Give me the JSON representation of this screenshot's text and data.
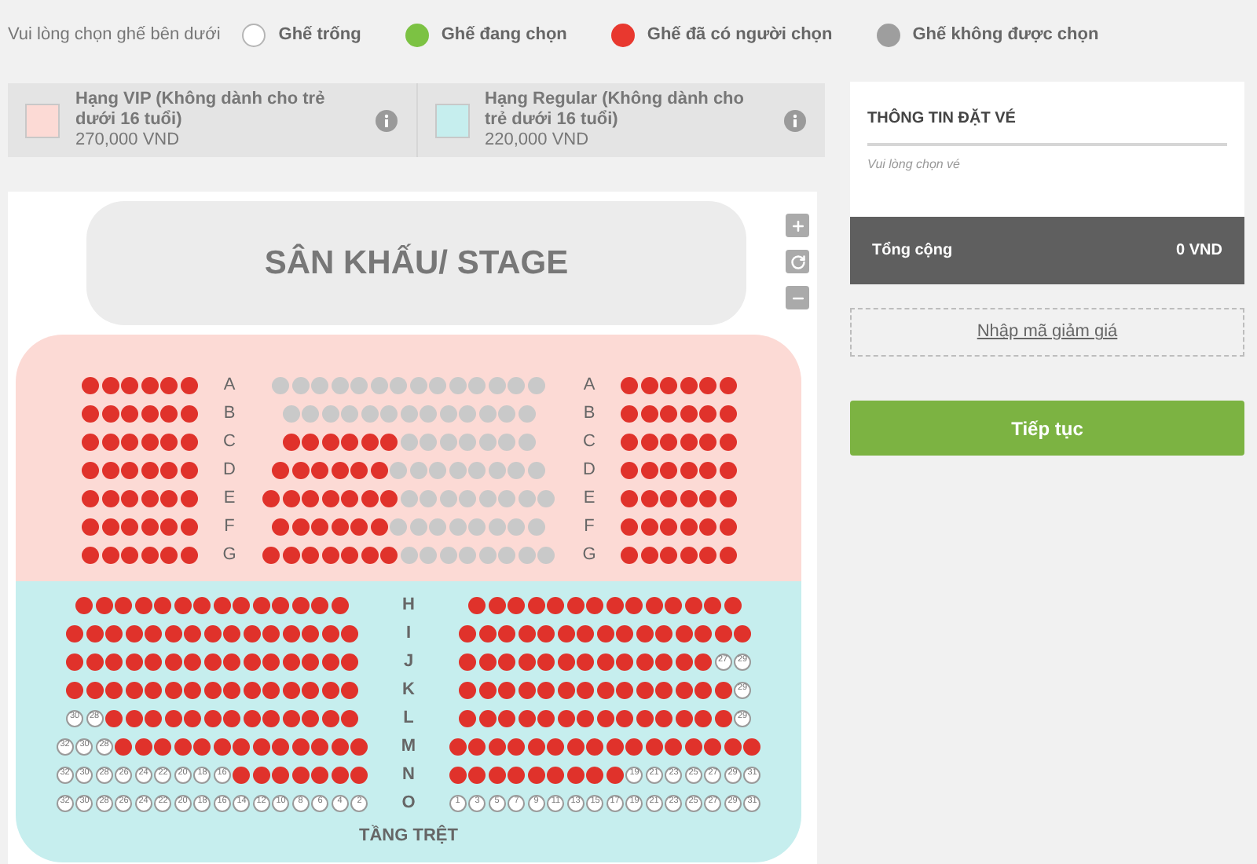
{
  "legend": {
    "prompt": "Vui lòng chọn ghế bên dưới",
    "items": [
      {
        "kind": "free",
        "label": "Ghế trống"
      },
      {
        "kind": "selected",
        "label": "Ghế đang chọn"
      },
      {
        "kind": "taken",
        "label": "Ghế đã có người chọn"
      },
      {
        "kind": "blocked",
        "label": "Ghế không được chọn"
      }
    ]
  },
  "ticket_classes": [
    {
      "name": "Hạng VIP (Không dành cho trẻ dưới 16 tuổi)",
      "price": "270,000 VND",
      "color": "#fcdad5"
    },
    {
      "name": "Hạng Regular (Không dành cho trẻ dưới 16 tuổi)",
      "price": "220,000 VND",
      "color": "#c6eeee"
    }
  ],
  "seat_map": {
    "stage": "SÂN KHẤU/ STAGE",
    "vip_section": {
      "color": "#fcdad5",
      "rows": [
        {
          "label_left": "A",
          "label_right": "A",
          "left": [
            {
              "kind": "taken"
            },
            {
              "kind": "taken"
            },
            {
              "kind": "taken"
            },
            {
              "kind": "taken"
            },
            {
              "kind": "taken"
            },
            {
              "kind": "taken"
            }
          ],
          "center": [
            {
              "kind": "blocked"
            },
            {
              "kind": "blocked"
            },
            {
              "kind": "blocked"
            },
            {
              "kind": "blocked"
            },
            {
              "kind": "blocked"
            },
            {
              "kind": "blocked"
            },
            {
              "kind": "blocked"
            },
            {
              "kind": "blocked"
            },
            {
              "kind": "blocked"
            },
            {
              "kind": "blocked"
            },
            {
              "kind": "blocked"
            },
            {
              "kind": "blocked"
            },
            {
              "kind": "blocked"
            },
            {
              "kind": "blocked"
            }
          ],
          "right": [
            {
              "kind": "taken"
            },
            {
              "kind": "taken"
            },
            {
              "kind": "taken"
            },
            {
              "kind": "taken"
            },
            {
              "kind": "taken"
            },
            {
              "kind": "taken"
            }
          ]
        },
        {
          "label_left": "B",
          "label_right": "B",
          "left": [
            {
              "kind": "taken"
            },
            {
              "kind": "taken"
            },
            {
              "kind": "taken"
            },
            {
              "kind": "taken"
            },
            {
              "kind": "taken"
            },
            {
              "kind": "taken"
            }
          ],
          "center": [
            {
              "kind": "blocked"
            },
            {
              "kind": "blocked"
            },
            {
              "kind": "blocked"
            },
            {
              "kind": "blocked"
            },
            {
              "kind": "blocked"
            },
            {
              "kind": "blocked"
            },
            {
              "kind": "blocked"
            },
            {
              "kind": "blocked"
            },
            {
              "kind": "blocked"
            },
            {
              "kind": "blocked"
            },
            {
              "kind": "blocked"
            },
            {
              "kind": "blocked"
            },
            {
              "kind": "blocked"
            }
          ],
          "right": [
            {
              "kind": "taken"
            },
            {
              "kind": "taken"
            },
            {
              "kind": "taken"
            },
            {
              "kind": "taken"
            },
            {
              "kind": "taken"
            },
            {
              "kind": "taken"
            }
          ]
        },
        {
          "label_left": "C",
          "label_right": "C",
          "left": [
            {
              "kind": "taken"
            },
            {
              "kind": "taken"
            },
            {
              "kind": "taken"
            },
            {
              "kind": "taken"
            },
            {
              "kind": "taken"
            },
            {
              "kind": "taken"
            }
          ],
          "center": [
            {
              "kind": "taken"
            },
            {
              "kind": "taken"
            },
            {
              "kind": "taken"
            },
            {
              "kind": "taken"
            },
            {
              "kind": "taken"
            },
            {
              "kind": "taken"
            },
            {
              "kind": "blocked"
            },
            {
              "kind": "blocked"
            },
            {
              "kind": "blocked"
            },
            {
              "kind": "blocked"
            },
            {
              "kind": "blocked"
            },
            {
              "kind": "blocked"
            },
            {
              "kind": "blocked"
            }
          ],
          "right": [
            {
              "kind": "taken"
            },
            {
              "kind": "taken"
            },
            {
              "kind": "taken"
            },
            {
              "kind": "taken"
            },
            {
              "kind": "taken"
            },
            {
              "kind": "taken"
            }
          ]
        },
        {
          "label_left": "D",
          "label_right": "D",
          "left": [
            {
              "kind": "taken"
            },
            {
              "kind": "taken"
            },
            {
              "kind": "taken"
            },
            {
              "kind": "taken"
            },
            {
              "kind": "taken"
            },
            {
              "kind": "taken"
            }
          ],
          "center": [
            {
              "kind": "taken"
            },
            {
              "kind": "taken"
            },
            {
              "kind": "taken"
            },
            {
              "kind": "taken"
            },
            {
              "kind": "taken"
            },
            {
              "kind": "taken"
            },
            {
              "kind": "blocked"
            },
            {
              "kind": "blocked"
            },
            {
              "kind": "blocked"
            },
            {
              "kind": "blocked"
            },
            {
              "kind": "blocked"
            },
            {
              "kind": "blocked"
            },
            {
              "kind": "blocked"
            },
            {
              "kind": "blocked"
            }
          ],
          "right": [
            {
              "kind": "taken"
            },
            {
              "kind": "taken"
            },
            {
              "kind": "taken"
            },
            {
              "kind": "taken"
            },
            {
              "kind": "taken"
            },
            {
              "kind": "taken"
            }
          ]
        },
        {
          "label_left": "E",
          "label_right": "E",
          "left": [
            {
              "kind": "taken"
            },
            {
              "kind": "taken"
            },
            {
              "kind": "taken"
            },
            {
              "kind": "taken"
            },
            {
              "kind": "taken"
            },
            {
              "kind": "taken"
            }
          ],
          "center": [
            {
              "kind": "taken"
            },
            {
              "kind": "taken"
            },
            {
              "kind": "taken"
            },
            {
              "kind": "taken"
            },
            {
              "kind": "taken"
            },
            {
              "kind": "taken"
            },
            {
              "kind": "taken"
            },
            {
              "kind": "blocked"
            },
            {
              "kind": "blocked"
            },
            {
              "kind": "blocked"
            },
            {
              "kind": "blocked"
            },
            {
              "kind": "blocked"
            },
            {
              "kind": "blocked"
            },
            {
              "kind": "blocked"
            },
            {
              "kind": "blocked"
            }
          ],
          "right": [
            {
              "kind": "taken"
            },
            {
              "kind": "taken"
            },
            {
              "kind": "taken"
            },
            {
              "kind": "taken"
            },
            {
              "kind": "taken"
            },
            {
              "kind": "taken"
            }
          ]
        },
        {
          "label_left": "F",
          "label_right": "F",
          "left": [
            {
              "kind": "taken"
            },
            {
              "kind": "taken"
            },
            {
              "kind": "taken"
            },
            {
              "kind": "taken"
            },
            {
              "kind": "taken"
            },
            {
              "kind": "taken"
            }
          ],
          "center": [
            {
              "kind": "taken"
            },
            {
              "kind": "taken"
            },
            {
              "kind": "taken"
            },
            {
              "kind": "taken"
            },
            {
              "kind": "taken"
            },
            {
              "kind": "taken"
            },
            {
              "kind": "blocked"
            },
            {
              "kind": "blocked"
            },
            {
              "kind": "blocked"
            },
            {
              "kind": "blocked"
            },
            {
              "kind": "blocked"
            },
            {
              "kind": "blocked"
            },
            {
              "kind": "blocked"
            },
            {
              "kind": "blocked"
            }
          ],
          "right": [
            {
              "kind": "taken"
            },
            {
              "kind": "taken"
            },
            {
              "kind": "taken"
            },
            {
              "kind": "taken"
            },
            {
              "kind": "taken"
            },
            {
              "kind": "taken"
            }
          ]
        },
        {
          "label_left": "G",
          "label_right": "G",
          "left": [
            {
              "kind": "taken"
            },
            {
              "kind": "taken"
            },
            {
              "kind": "taken"
            },
            {
              "kind": "taken"
            },
            {
              "kind": "taken"
            },
            {
              "kind": "taken"
            }
          ],
          "center": [
            {
              "kind": "taken"
            },
            {
              "kind": "taken"
            },
            {
              "kind": "taken"
            },
            {
              "kind": "taken"
            },
            {
              "kind": "taken"
            },
            {
              "kind": "taken"
            },
            {
              "kind": "taken"
            },
            {
              "kind": "blocked"
            },
            {
              "kind": "blocked"
            },
            {
              "kind": "blocked"
            },
            {
              "kind": "blocked"
            },
            {
              "kind": "blocked"
            },
            {
              "kind": "blocked"
            },
            {
              "kind": "blocked"
            },
            {
              "kind": "blocked"
            }
          ],
          "right": [
            {
              "kind": "taken"
            },
            {
              "kind": "taken"
            },
            {
              "kind": "taken"
            },
            {
              "kind": "taken"
            },
            {
              "kind": "taken"
            },
            {
              "kind": "taken"
            }
          ]
        }
      ]
    },
    "regular_section": {
      "color": "#c6eeee",
      "title": "TẦNG TRỆT",
      "rows": [
        {
          "label": "H",
          "left": [
            {
              "kind": "taken"
            },
            {
              "kind": "taken"
            },
            {
              "kind": "taken"
            },
            {
              "kind": "taken"
            },
            {
              "kind": "taken"
            },
            {
              "kind": "taken"
            },
            {
              "kind": "taken"
            },
            {
              "kind": "taken"
            },
            {
              "kind": "taken"
            },
            {
              "kind": "taken"
            },
            {
              "kind": "taken"
            },
            {
              "kind": "taken"
            },
            {
              "kind": "taken"
            },
            {
              "kind": "taken"
            }
          ],
          "right": [
            {
              "kind": "taken"
            },
            {
              "kind": "taken"
            },
            {
              "kind": "taken"
            },
            {
              "kind": "taken"
            },
            {
              "kind": "taken"
            },
            {
              "kind": "taken"
            },
            {
              "kind": "taken"
            },
            {
              "kind": "taken"
            },
            {
              "kind": "taken"
            },
            {
              "kind": "taken"
            },
            {
              "kind": "taken"
            },
            {
              "kind": "taken"
            },
            {
              "kind": "taken"
            },
            {
              "kind": "taken"
            }
          ]
        },
        {
          "label": "I",
          "left": [
            {
              "kind": "taken"
            },
            {
              "kind": "taken"
            },
            {
              "kind": "taken"
            },
            {
              "kind": "taken"
            },
            {
              "kind": "taken"
            },
            {
              "kind": "taken"
            },
            {
              "kind": "taken"
            },
            {
              "kind": "taken"
            },
            {
              "kind": "taken"
            },
            {
              "kind": "taken"
            },
            {
              "kind": "taken"
            },
            {
              "kind": "taken"
            },
            {
              "kind": "taken"
            },
            {
              "kind": "taken"
            },
            {
              "kind": "taken"
            }
          ],
          "right": [
            {
              "kind": "taken"
            },
            {
              "kind": "taken"
            },
            {
              "kind": "taken"
            },
            {
              "kind": "taken"
            },
            {
              "kind": "taken"
            },
            {
              "kind": "taken"
            },
            {
              "kind": "taken"
            },
            {
              "kind": "taken"
            },
            {
              "kind": "taken"
            },
            {
              "kind": "taken"
            },
            {
              "kind": "taken"
            },
            {
              "kind": "taken"
            },
            {
              "kind": "taken"
            },
            {
              "kind": "taken"
            },
            {
              "kind": "taken"
            }
          ]
        },
        {
          "label": "J",
          "left": [
            {
              "kind": "taken"
            },
            {
              "kind": "taken"
            },
            {
              "kind": "taken"
            },
            {
              "kind": "taken"
            },
            {
              "kind": "taken"
            },
            {
              "kind": "taken"
            },
            {
              "kind": "taken"
            },
            {
              "kind": "taken"
            },
            {
              "kind": "taken"
            },
            {
              "kind": "taken"
            },
            {
              "kind": "taken"
            },
            {
              "kind": "taken"
            },
            {
              "kind": "taken"
            },
            {
              "kind": "taken"
            },
            {
              "kind": "taken"
            }
          ],
          "right": [
            {
              "kind": "taken"
            },
            {
              "kind": "taken"
            },
            {
              "kind": "taken"
            },
            {
              "kind": "taken"
            },
            {
              "kind": "taken"
            },
            {
              "kind": "taken"
            },
            {
              "kind": "taken"
            },
            {
              "kind": "taken"
            },
            {
              "kind": "taken"
            },
            {
              "kind": "taken"
            },
            {
              "kind": "taken"
            },
            {
              "kind": "taken"
            },
            {
              "kind": "taken"
            },
            {
              "kind": "free",
              "number": "27"
            },
            {
              "kind": "free",
              "number": "29"
            }
          ]
        },
        {
          "label": "K",
          "left": [
            {
              "kind": "taken"
            },
            {
              "kind": "taken"
            },
            {
              "kind": "taken"
            },
            {
              "kind": "taken"
            },
            {
              "kind": "taken"
            },
            {
              "kind": "taken"
            },
            {
              "kind": "taken"
            },
            {
              "kind": "taken"
            },
            {
              "kind": "taken"
            },
            {
              "kind": "taken"
            },
            {
              "kind": "taken"
            },
            {
              "kind": "taken"
            },
            {
              "kind": "taken"
            },
            {
              "kind": "taken"
            },
            {
              "kind": "taken"
            }
          ],
          "right": [
            {
              "kind": "taken"
            },
            {
              "kind": "taken"
            },
            {
              "kind": "taken"
            },
            {
              "kind": "taken"
            },
            {
              "kind": "taken"
            },
            {
              "kind": "taken"
            },
            {
              "kind": "taken"
            },
            {
              "kind": "taken"
            },
            {
              "kind": "taken"
            },
            {
              "kind": "taken"
            },
            {
              "kind": "taken"
            },
            {
              "kind": "taken"
            },
            {
              "kind": "taken"
            },
            {
              "kind": "taken"
            },
            {
              "kind": "free",
              "number": "29"
            }
          ]
        },
        {
          "label": "L",
          "left": [
            {
              "kind": "free",
              "number": "30"
            },
            {
              "kind": "free",
              "number": "28"
            },
            {
              "kind": "taken"
            },
            {
              "kind": "taken"
            },
            {
              "kind": "taken"
            },
            {
              "kind": "taken"
            },
            {
              "kind": "taken"
            },
            {
              "kind": "taken"
            },
            {
              "kind": "taken"
            },
            {
              "kind": "taken"
            },
            {
              "kind": "taken"
            },
            {
              "kind": "taken"
            },
            {
              "kind": "taken"
            },
            {
              "kind": "taken"
            },
            {
              "kind": "taken"
            }
          ],
          "right": [
            {
              "kind": "taken"
            },
            {
              "kind": "taken"
            },
            {
              "kind": "taken"
            },
            {
              "kind": "taken"
            },
            {
              "kind": "taken"
            },
            {
              "kind": "taken"
            },
            {
              "kind": "taken"
            },
            {
              "kind": "taken"
            },
            {
              "kind": "taken"
            },
            {
              "kind": "taken"
            },
            {
              "kind": "taken"
            },
            {
              "kind": "taken"
            },
            {
              "kind": "taken"
            },
            {
              "kind": "taken"
            },
            {
              "kind": "free",
              "number": "29"
            }
          ]
        },
        {
          "label": "M",
          "left": [
            {
              "kind": "free",
              "number": "32"
            },
            {
              "kind": "free",
              "number": "30"
            },
            {
              "kind": "free",
              "number": "28"
            },
            {
              "kind": "taken"
            },
            {
              "kind": "taken"
            },
            {
              "kind": "taken"
            },
            {
              "kind": "taken"
            },
            {
              "kind": "taken"
            },
            {
              "kind": "taken"
            },
            {
              "kind": "taken"
            },
            {
              "kind": "taken"
            },
            {
              "kind": "taken"
            },
            {
              "kind": "taken"
            },
            {
              "kind": "taken"
            },
            {
              "kind": "taken"
            },
            {
              "kind": "taken"
            }
          ],
          "right": [
            {
              "kind": "taken"
            },
            {
              "kind": "taken"
            },
            {
              "kind": "taken"
            },
            {
              "kind": "taken"
            },
            {
              "kind": "taken"
            },
            {
              "kind": "taken"
            },
            {
              "kind": "taken"
            },
            {
              "kind": "taken"
            },
            {
              "kind": "taken"
            },
            {
              "kind": "taken"
            },
            {
              "kind": "taken"
            },
            {
              "kind": "taken"
            },
            {
              "kind": "taken"
            },
            {
              "kind": "taken"
            },
            {
              "kind": "taken"
            },
            {
              "kind": "taken"
            }
          ]
        },
        {
          "label": "N",
          "left": [
            {
              "kind": "free",
              "number": "32"
            },
            {
              "kind": "free",
              "number": "30"
            },
            {
              "kind": "free",
              "number": "28"
            },
            {
              "kind": "free",
              "number": "26"
            },
            {
              "kind": "free",
              "number": "24"
            },
            {
              "kind": "free",
              "number": "22"
            },
            {
              "kind": "free",
              "number": "20"
            },
            {
              "kind": "free",
              "number": "18"
            },
            {
              "kind": "free",
              "number": "16"
            },
            {
              "kind": "taken"
            },
            {
              "kind": "taken"
            },
            {
              "kind": "taken"
            },
            {
              "kind": "taken"
            },
            {
              "kind": "taken"
            },
            {
              "kind": "taken"
            },
            {
              "kind": "taken"
            }
          ],
          "right": [
            {
              "kind": "taken"
            },
            {
              "kind": "taken"
            },
            {
              "kind": "taken"
            },
            {
              "kind": "taken"
            },
            {
              "kind": "taken"
            },
            {
              "kind": "taken"
            },
            {
              "kind": "taken"
            },
            {
              "kind": "taken"
            },
            {
              "kind": "taken"
            },
            {
              "kind": "free",
              "number": "19"
            },
            {
              "kind": "free",
              "number": "21"
            },
            {
              "kind": "free",
              "number": "23"
            },
            {
              "kind": "free",
              "number": "25"
            },
            {
              "kind": "free",
              "number": "27"
            },
            {
              "kind": "free",
              "number": "29"
            },
            {
              "kind": "free",
              "number": "31"
            }
          ]
        },
        {
          "label": "O",
          "left": [
            {
              "kind": "free",
              "number": "32"
            },
            {
              "kind": "free",
              "number": "30"
            },
            {
              "kind": "free",
              "number": "28"
            },
            {
              "kind": "free",
              "number": "26"
            },
            {
              "kind": "free",
              "number": "24"
            },
            {
              "kind": "free",
              "number": "22"
            },
            {
              "kind": "free",
              "number": "20"
            },
            {
              "kind": "free",
              "number": "18"
            },
            {
              "kind": "free",
              "number": "16"
            },
            {
              "kind": "free",
              "number": "14"
            },
            {
              "kind": "free",
              "number": "12"
            },
            {
              "kind": "free",
              "number": "10"
            },
            {
              "kind": "free",
              "number": "8"
            },
            {
              "kind": "free",
              "number": "6"
            },
            {
              "kind": "free",
              "number": "4"
            },
            {
              "kind": "free",
              "number": "2"
            }
          ],
          "right": [
            {
              "kind": "free",
              "number": "1"
            },
            {
              "kind": "free",
              "number": "3"
            },
            {
              "kind": "free",
              "number": "5"
            },
            {
              "kind": "free",
              "number": "7"
            },
            {
              "kind": "free",
              "number": "9"
            },
            {
              "kind": "free",
              "number": "11"
            },
            {
              "kind": "free",
              "number": "13"
            },
            {
              "kind": "free",
              "number": "15"
            },
            {
              "kind": "free",
              "number": "17"
            },
            {
              "kind": "free",
              "number": "19"
            },
            {
              "kind": "free",
              "number": "21"
            },
            {
              "kind": "free",
              "number": "23"
            },
            {
              "kind": "free",
              "number": "25"
            },
            {
              "kind": "free",
              "number": "27"
            },
            {
              "kind": "free",
              "number": "29"
            },
            {
              "kind": "free",
              "number": "31"
            }
          ]
        }
      ]
    }
  },
  "booking": {
    "title": "THÔNG TIN ĐẶT VÉ",
    "empty_note": "Vui lòng chọn vé",
    "total_label": "Tổng cộng",
    "total_value": "0 VND",
    "discount_link": "Nhập mã giảm giá",
    "continue_button": "Tiếp tục"
  }
}
